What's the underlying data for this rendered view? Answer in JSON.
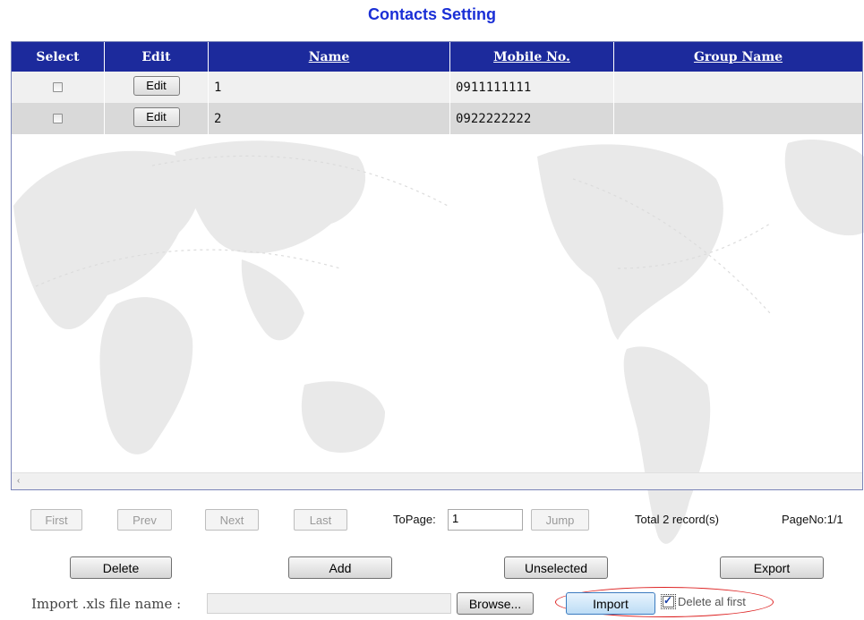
{
  "page": {
    "title": "Contacts Setting"
  },
  "grid": {
    "columns": [
      "Select",
      "Edit",
      "Name",
      "Mobile No.",
      "Group Name"
    ],
    "rows": [
      {
        "checked": false,
        "edit_label": "Edit",
        "name": "1",
        "mobile": "0911111111",
        "group": ""
      },
      {
        "checked": false,
        "edit_label": "Edit",
        "name": "2",
        "mobile": "0922222222",
        "group": ""
      }
    ],
    "scroll_arrow": "‹"
  },
  "pager": {
    "first": "First",
    "prev": "Prev",
    "next": "Next",
    "last": "Last",
    "topage_label": "ToPage:",
    "topage_value": "1",
    "jump": "Jump",
    "total": "Total 2 record(s)",
    "pageno": "PageNo:1/1"
  },
  "actions": {
    "delete": "Delete",
    "add": "Add",
    "unselected": "Unselected",
    "export": "Export"
  },
  "import": {
    "label": "Import .xls file name :",
    "file_value": "",
    "browse": "Browse...",
    "import_button": "Import",
    "delete_first_label": "Delete al first",
    "delete_first_checked": true
  },
  "colors": {
    "title": "#1a2fd6",
    "header_bg": "#1c2a9c",
    "row_odd": "#f0f0f0",
    "row_even": "#d9d9d9",
    "highlight_oval": "#d22222"
  }
}
